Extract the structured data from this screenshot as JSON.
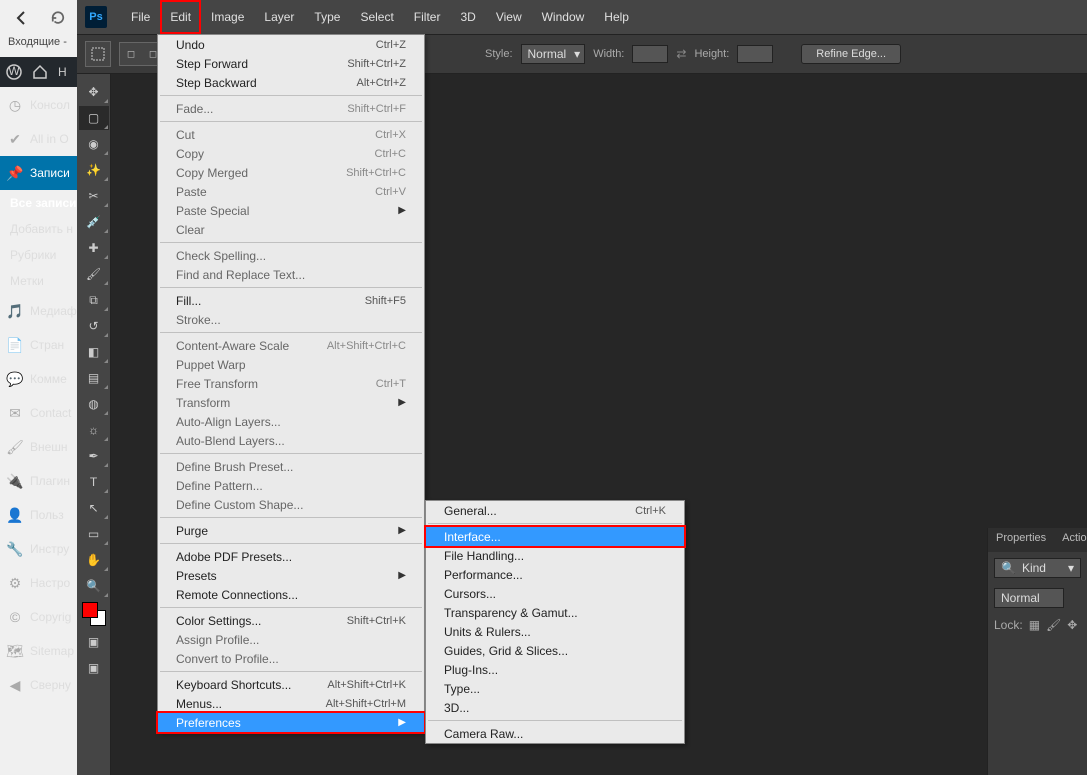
{
  "browser": {
    "tab_title": "Входящие -"
  },
  "wp": {
    "adminbar": {
      "home_label": "H"
    },
    "items": [
      {
        "icon": "dashboard",
        "label": "Консол"
      },
      {
        "icon": "allinone",
        "label": "All in O"
      },
      {
        "icon": "pin",
        "label": "Записи",
        "active": true
      },
      {
        "sub": true,
        "label": "Все записи",
        "current": true
      },
      {
        "sub": true,
        "label": "Добавить н"
      },
      {
        "sub": true,
        "label": "Рубрики"
      },
      {
        "sub": true,
        "label": "Метки"
      },
      {
        "icon": "media",
        "label": "Медиаф"
      },
      {
        "icon": "pages",
        "label": "Стран"
      },
      {
        "icon": "comments",
        "label": "Комме"
      },
      {
        "icon": "contact",
        "label": "Contact"
      },
      {
        "icon": "appearance",
        "label": "Внешн"
      },
      {
        "icon": "plugins",
        "label": "Плагин"
      },
      {
        "icon": "users",
        "label": "Польз"
      },
      {
        "icon": "tools",
        "label": "Инстру"
      },
      {
        "icon": "settings",
        "label": "Настро"
      },
      {
        "icon": "copyright",
        "label": "Copyrig"
      },
      {
        "icon": "sitemap",
        "label": "Sitemap"
      },
      {
        "icon": "collapse",
        "label": "Сверну"
      }
    ]
  },
  "ps": {
    "menubar": [
      "File",
      "Edit",
      "Image",
      "Layer",
      "Type",
      "Select",
      "Filter",
      "3D",
      "View",
      "Window",
      "Help"
    ],
    "options": {
      "style_label": "Style:",
      "style_value": "Normal",
      "width_label": "Width:",
      "height_label": "Height:",
      "refine": "Refine Edge..."
    },
    "edit_menu": [
      {
        "label": "Undo",
        "shortcut": "Ctrl+Z",
        "enabled": true
      },
      {
        "label": "Step Forward",
        "shortcut": "Shift+Ctrl+Z",
        "enabled": true
      },
      {
        "label": "Step Backward",
        "shortcut": "Alt+Ctrl+Z",
        "enabled": true
      },
      {
        "sep": true
      },
      {
        "label": "Fade...",
        "shortcut": "Shift+Ctrl+F",
        "enabled": false
      },
      {
        "sep": true
      },
      {
        "label": "Cut",
        "shortcut": "Ctrl+X",
        "enabled": false
      },
      {
        "label": "Copy",
        "shortcut": "Ctrl+C",
        "enabled": false
      },
      {
        "label": "Copy Merged",
        "shortcut": "Shift+Ctrl+C",
        "enabled": false
      },
      {
        "label": "Paste",
        "shortcut": "Ctrl+V",
        "enabled": false
      },
      {
        "label": "Paste Special",
        "submenu": true,
        "enabled": false
      },
      {
        "label": "Clear",
        "enabled": false
      },
      {
        "sep": true
      },
      {
        "label": "Check Spelling...",
        "enabled": false
      },
      {
        "label": "Find and Replace Text...",
        "enabled": false
      },
      {
        "sep": true
      },
      {
        "label": "Fill...",
        "shortcut": "Shift+F5",
        "enabled": true
      },
      {
        "label": "Stroke...",
        "enabled": false
      },
      {
        "sep": true
      },
      {
        "label": "Content-Aware Scale",
        "shortcut": "Alt+Shift+Ctrl+C",
        "enabled": false
      },
      {
        "label": "Puppet Warp",
        "enabled": false
      },
      {
        "label": "Free Transform",
        "shortcut": "Ctrl+T",
        "enabled": false
      },
      {
        "label": "Transform",
        "submenu": true,
        "enabled": false
      },
      {
        "label": "Auto-Align Layers...",
        "enabled": false
      },
      {
        "label": "Auto-Blend Layers...",
        "enabled": false
      },
      {
        "sep": true
      },
      {
        "label": "Define Brush Preset...",
        "enabled": false
      },
      {
        "label": "Define Pattern...",
        "enabled": false
      },
      {
        "label": "Define Custom Shape...",
        "enabled": false
      },
      {
        "sep": true
      },
      {
        "label": "Purge",
        "submenu": true,
        "enabled": true
      },
      {
        "sep": true
      },
      {
        "label": "Adobe PDF Presets...",
        "enabled": true
      },
      {
        "label": "Presets",
        "submenu": true,
        "enabled": true
      },
      {
        "label": "Remote Connections...",
        "enabled": true
      },
      {
        "sep": true
      },
      {
        "label": "Color Settings...",
        "shortcut": "Shift+Ctrl+K",
        "enabled": true
      },
      {
        "label": "Assign Profile...",
        "enabled": false
      },
      {
        "label": "Convert to Profile...",
        "enabled": false
      },
      {
        "sep": true
      },
      {
        "label": "Keyboard Shortcuts...",
        "shortcut": "Alt+Shift+Ctrl+K",
        "enabled": true
      },
      {
        "label": "Menus...",
        "shortcut": "Alt+Shift+Ctrl+M",
        "enabled": true
      },
      {
        "label": "Preferences",
        "submenu": true,
        "enabled": true,
        "hover": true,
        "boxed": true
      }
    ],
    "prefs_menu": [
      {
        "label": "General...",
        "shortcut": "Ctrl+K",
        "enabled": true
      },
      {
        "sep": true
      },
      {
        "label": "Interface...",
        "enabled": true,
        "hover": true,
        "boxed": true
      },
      {
        "label": "File Handling...",
        "enabled": true
      },
      {
        "label": "Performance...",
        "enabled": true
      },
      {
        "label": "Cursors...",
        "enabled": true
      },
      {
        "label": "Transparency & Gamut...",
        "enabled": true
      },
      {
        "label": "Units & Rulers...",
        "enabled": true
      },
      {
        "label": "Guides, Grid & Slices...",
        "enabled": true
      },
      {
        "label": "Plug-Ins...",
        "enabled": true
      },
      {
        "label": "Type...",
        "enabled": true
      },
      {
        "label": "3D...",
        "enabled": true
      },
      {
        "sep": true
      },
      {
        "label": "Camera Raw...",
        "enabled": true
      }
    ],
    "panels": {
      "tabs": [
        "Properties",
        "Action"
      ],
      "kind_label": "Kind",
      "blend": "Normal",
      "lock_label": "Lock:"
    }
  }
}
